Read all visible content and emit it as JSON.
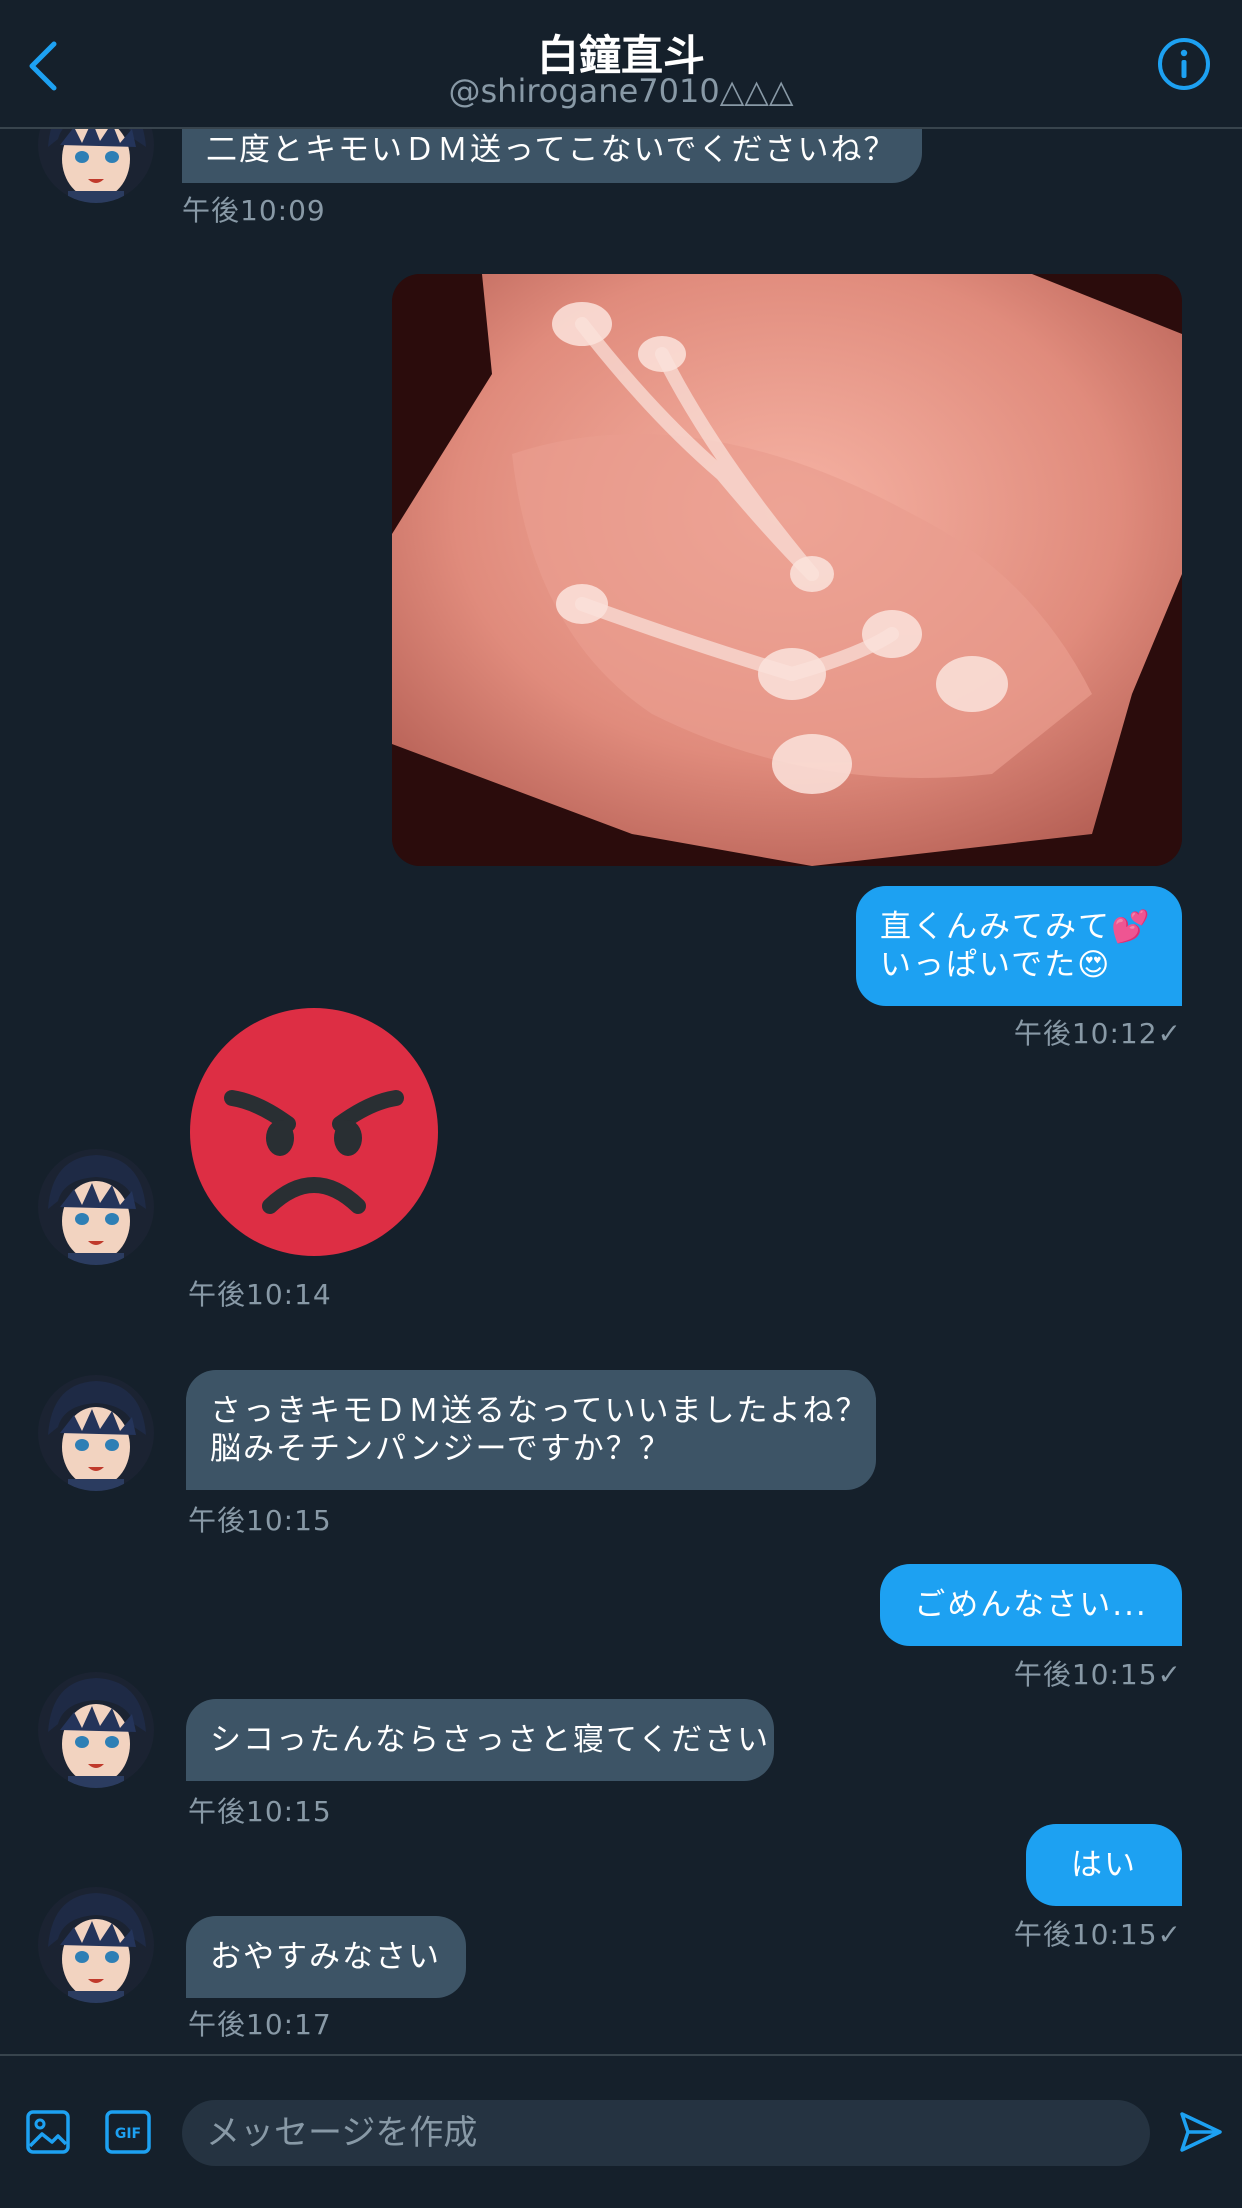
{
  "header": {
    "title": "白鐘直斗",
    "handle": "@shirogane7010△△△",
    "back_icon": "chevron-left-icon",
    "info_icon": "info-icon"
  },
  "messages": [
    {
      "id": "m1",
      "side": "in",
      "lines": [
        "二度とキモいＤＭ送ってこないでくださいね？"
      ],
      "time": "午後10:09"
    },
    {
      "id": "m2",
      "side": "out",
      "type": "image",
      "description_hidden": true
    },
    {
      "id": "m3",
      "side": "out",
      "lines": [
        "直くんみてみて💕",
        "いっぱいでた😍"
      ],
      "time": "午後10:12✓"
    },
    {
      "id": "m4",
      "side": "in",
      "type": "emoji",
      "emoji": "angry-face",
      "time": "午後10:14"
    },
    {
      "id": "m5",
      "side": "in",
      "lines": [
        "さっきキモＤＭ送るなっていいましたよね？",
        "脳みそチンパンジーですか？？"
      ],
      "time": "午後10:15"
    },
    {
      "id": "m6",
      "side": "out",
      "lines": [
        "ごめんなさい..."
      ],
      "time": "午後10:15✓"
    },
    {
      "id": "m7",
      "side": "in",
      "lines": [
        "シコったんならさっさと寝てください"
      ],
      "time": "午後10:15"
    },
    {
      "id": "m8",
      "side": "out",
      "lines": [
        "はい"
      ],
      "time": "午後10:15✓"
    },
    {
      "id": "m9",
      "side": "in",
      "lines": [
        "おやすみなさい"
      ],
      "time": "午後10:17"
    }
  ],
  "composer": {
    "placeholder": "メッセージを作成",
    "image_icon": "image-icon",
    "gif_icon": "gif-icon",
    "gif_label": "GIF",
    "send_icon": "send-icon"
  },
  "colors": {
    "background": "#15202b",
    "incoming_bubble": "#3d5466",
    "outgoing_bubble": "#1da1f2",
    "accent": "#1da1f2",
    "muted_text": "#8899a6",
    "angry_face": "#dd2e44"
  }
}
